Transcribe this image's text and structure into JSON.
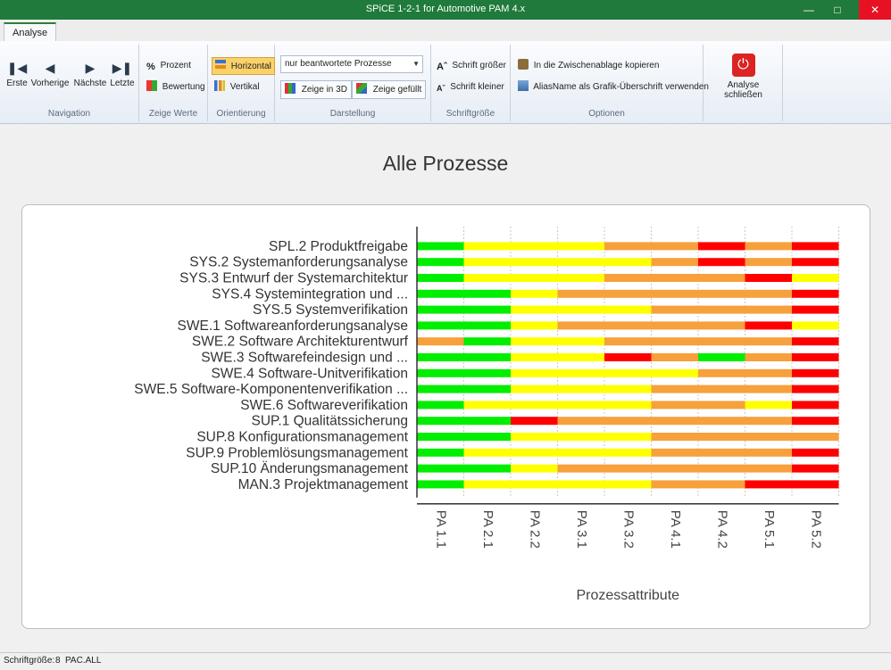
{
  "window": {
    "title": "SPiCE 1-2-1 for Automotive PAM 4.x"
  },
  "tabs": [
    {
      "label": "Analyse"
    }
  ],
  "ribbon": {
    "navigation": {
      "label": "Navigation",
      "buttons": [
        "Erste",
        "Vorherige",
        "Nächste",
        "Letzte"
      ]
    },
    "zeige_werte": {
      "label": "Zeige Werte",
      "prozent": "Prozent",
      "bewertung": "Bewertung"
    },
    "orientierung": {
      "label": "Orientierung",
      "horizontal": "Horizontal",
      "vertikal": "Vertikal"
    },
    "darstellung": {
      "label": "Darstellung",
      "filter_value": "nur beantwortete Prozesse anzeigen",
      "zeige_3d": "Zeige in 3D",
      "zeige_gefuellt": "Zeige gefüllt"
    },
    "schriftgroesse": {
      "label": "Schriftgröße",
      "groesser": "Schrift größer",
      "kleiner": "Schrift kleiner"
    },
    "optionen": {
      "label": "Optionen",
      "clipboard": "In die Zwischenablage kopieren",
      "aliasname": "AliasName als Grafik-Überschrift verwenden"
    },
    "close": {
      "label": "Analyse schließen"
    }
  },
  "page": {
    "title": "Alle Prozesse"
  },
  "chart_data": {
    "type": "heatmap",
    "xlabel": "Prozessattribute",
    "attributes": [
      "PA 1.1",
      "PA 2.1",
      "PA 2.2",
      "PA 3.1",
      "PA 3.2",
      "PA 4.1",
      "PA 4.2",
      "PA 5.1",
      "PA 5.2"
    ],
    "scale": {
      "F": "#00ee00",
      "L": "#ffff00",
      "P": "#f7a03c",
      "N": "#ff0000"
    },
    "processes": [
      {
        "label": "SPL.2 Produktfreigabe",
        "ratings": [
          "F",
          "L",
          "L",
          "L",
          "P",
          "P",
          "N",
          "P",
          "N"
        ]
      },
      {
        "label": "SYS.2 Systemanforderungsanalyse",
        "ratings": [
          "F",
          "L",
          "L",
          "L",
          "L",
          "P",
          "N",
          "P",
          "N"
        ]
      },
      {
        "label": "SYS.3 Entwurf der Systemarchitektur",
        "ratings": [
          "F",
          "L",
          "L",
          "L",
          "P",
          "P",
          "P",
          "N",
          "L"
        ]
      },
      {
        "label": "SYS.4 Systemintegration und ...",
        "ratings": [
          "F",
          "F",
          "L",
          "P",
          "P",
          "P",
          "P",
          "P",
          "N"
        ]
      },
      {
        "label": "SYS.5 Systemverifikation",
        "ratings": [
          "F",
          "F",
          "L",
          "L",
          "L",
          "P",
          "P",
          "P",
          "N"
        ]
      },
      {
        "label": "SWE.1 Softwareanforderungsanalyse",
        "ratings": [
          "F",
          "F",
          "L",
          "P",
          "P",
          "P",
          "P",
          "N",
          "L"
        ]
      },
      {
        "label": "SWE.2 Software Architekturentwurf",
        "ratings": [
          "P",
          "F",
          "L",
          "L",
          "P",
          "P",
          "P",
          "P",
          "N"
        ]
      },
      {
        "label": "SWE.3 Softwarefeindesign und ...",
        "ratings": [
          "F",
          "F",
          "L",
          "L",
          "N",
          "P",
          "F",
          "P",
          "N"
        ]
      },
      {
        "label": "SWE.4 Software-Unitverifikation",
        "ratings": [
          "F",
          "F",
          "L",
          "L",
          "L",
          "L",
          "P",
          "P",
          "N"
        ]
      },
      {
        "label": "SWE.5 Software-Komponentenverifikation ...",
        "ratings": [
          "F",
          "F",
          "L",
          "L",
          "L",
          "P",
          "P",
          "P",
          "N"
        ]
      },
      {
        "label": "SWE.6 Softwareverifikation",
        "ratings": [
          "F",
          "L",
          "L",
          "L",
          "L",
          "P",
          "P",
          "L",
          "N"
        ]
      },
      {
        "label": "SUP.1 Qualitätssicherung",
        "ratings": [
          "F",
          "F",
          "N",
          "P",
          "P",
          "P",
          "P",
          "P",
          "N"
        ]
      },
      {
        "label": "SUP.8 Konfigurationsmanagement",
        "ratings": [
          "F",
          "F",
          "L",
          "L",
          "L",
          "P",
          "P",
          "P",
          "P"
        ]
      },
      {
        "label": "SUP.9 Problemlösungsmanagement",
        "ratings": [
          "F",
          "L",
          "L",
          "L",
          "L",
          "P",
          "P",
          "P",
          "N"
        ]
      },
      {
        "label": "SUP.10 Änderungsmanagement",
        "ratings": [
          "F",
          "F",
          "L",
          "P",
          "P",
          "P",
          "P",
          "P",
          "N"
        ]
      },
      {
        "label": "MAN.3 Projektmanagement",
        "ratings": [
          "F",
          "L",
          "L",
          "L",
          "L",
          "P",
          "P",
          "N",
          "N"
        ]
      }
    ]
  },
  "statusbar": {
    "font_label": "Schriftgröße:",
    "font_size": "8",
    "file": "PAC.ALL"
  }
}
